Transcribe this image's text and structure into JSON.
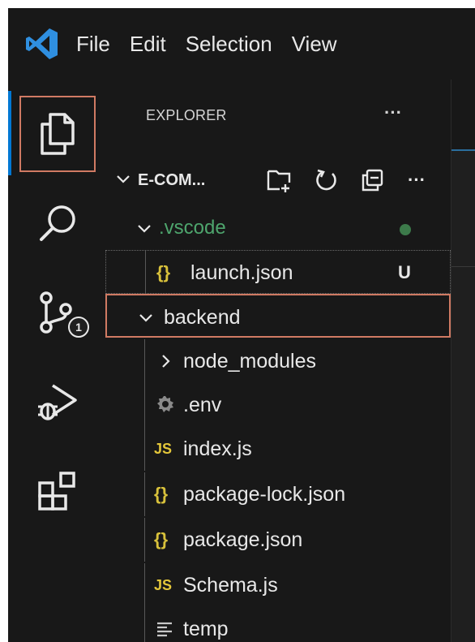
{
  "menubar": {
    "logo_icon": "vscode-logo-icon",
    "items": [
      "File",
      "Edit",
      "Selection",
      "View"
    ]
  },
  "activitybar": {
    "items": [
      {
        "id": "explorer",
        "icon": "files-icon",
        "selected": true
      },
      {
        "id": "search",
        "icon": "search-icon"
      },
      {
        "id": "source-control",
        "icon": "source-control-icon",
        "badge": "1"
      },
      {
        "id": "run-debug",
        "icon": "run-debug-icon"
      },
      {
        "id": "extensions",
        "icon": "extensions-icon"
      }
    ]
  },
  "explorer": {
    "title": "EXPLORER",
    "more": "···",
    "root": {
      "label": "E-COM...",
      "actions": [
        "new-file-icon",
        "refresh-icon",
        "collapse-all-icon",
        "more-icon"
      ],
      "more": "···"
    },
    "tree": [
      {
        "label": ".vscode",
        "type": "folder",
        "expanded": true,
        "color": "#4ea56d",
        "status": "modified-dot"
      },
      {
        "label": "launch.json",
        "type": "json",
        "icon_text": "{}",
        "status_text": "U",
        "color": "#e8e8e8"
      },
      {
        "label": "backend",
        "type": "folder",
        "expanded": true,
        "selected": true
      },
      {
        "label": "node_modules",
        "type": "folder",
        "expanded": false
      },
      {
        "label": ".env",
        "type": "env",
        "icon": "gear-icon"
      },
      {
        "label": "index.js",
        "type": "js",
        "icon_text": "JS"
      },
      {
        "label": "package-lock.json",
        "type": "json",
        "icon_text": "{}"
      },
      {
        "label": "package.json",
        "type": "json",
        "icon_text": "{}"
      },
      {
        "label": "Schema.js",
        "type": "js",
        "icon_text": "JS"
      },
      {
        "label": "temp",
        "type": "text",
        "icon": "text-file-icon"
      }
    ]
  },
  "colors": {
    "background": "#181818",
    "editor_background": "#1f1f1f",
    "accent": "#0078d4",
    "selection_border": "#d07a63",
    "git_untracked": "#4ea56d",
    "json_icon": "#d8c13b",
    "js_icon": "#e3c63a"
  }
}
